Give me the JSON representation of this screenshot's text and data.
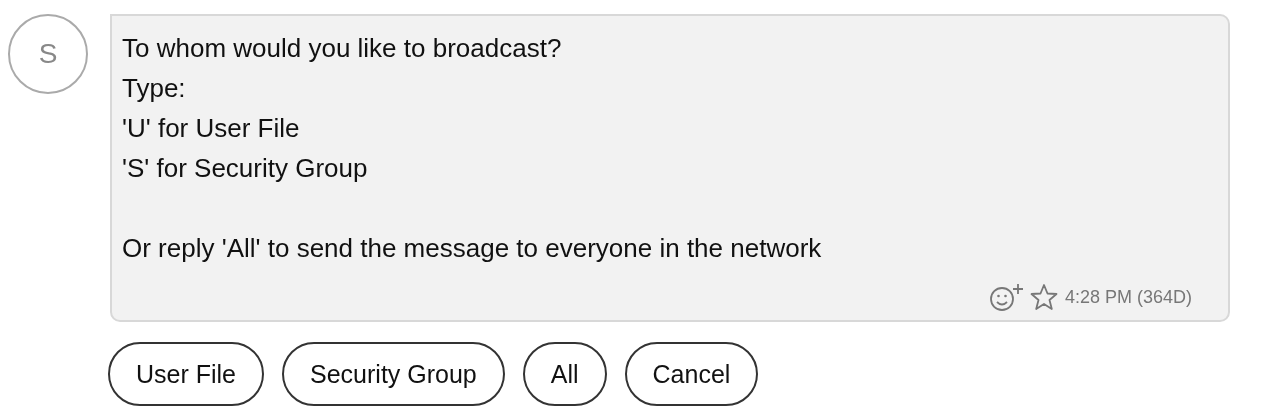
{
  "avatar": {
    "initial": "S"
  },
  "message": {
    "paragraphs": [
      [
        "To whom would you like to broadcast?",
        "Type:",
        "'U' for User File",
        "'S' for Security Group"
      ],
      [
        "Or reply 'All' to send the message to everyone in the network"
      ]
    ],
    "starred": false,
    "time": "4:28 PM (364D)"
  },
  "buttons": [
    "User File",
    "Security Group",
    "All",
    "Cancel"
  ]
}
